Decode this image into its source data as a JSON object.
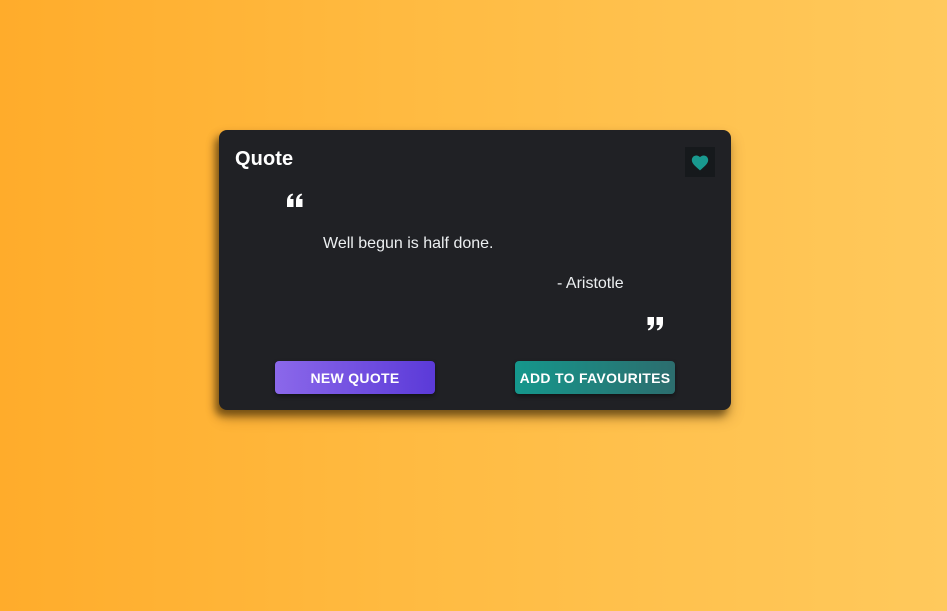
{
  "card": {
    "title": "Quote",
    "favourite_icon": "heart-icon",
    "open_quote_icon": "open-quote-icon",
    "close_quote_icon": "close-quote-icon",
    "quote_text": "Well begun is half done.",
    "author": "- Aristotle"
  },
  "actions": {
    "new_quote_label": "NEW QUOTE",
    "add_favourite_label": "ADD TO FAVOURITES"
  },
  "colors": {
    "background_start": "#ffac2b",
    "background_end": "#ffc95c",
    "card_background": "#202125",
    "heart": "#19998f",
    "new_quote_start": "#8b68ea",
    "new_quote_end": "#5b3ad8",
    "favourite_start": "#15978c",
    "favourite_end": "#2c6d6e"
  }
}
